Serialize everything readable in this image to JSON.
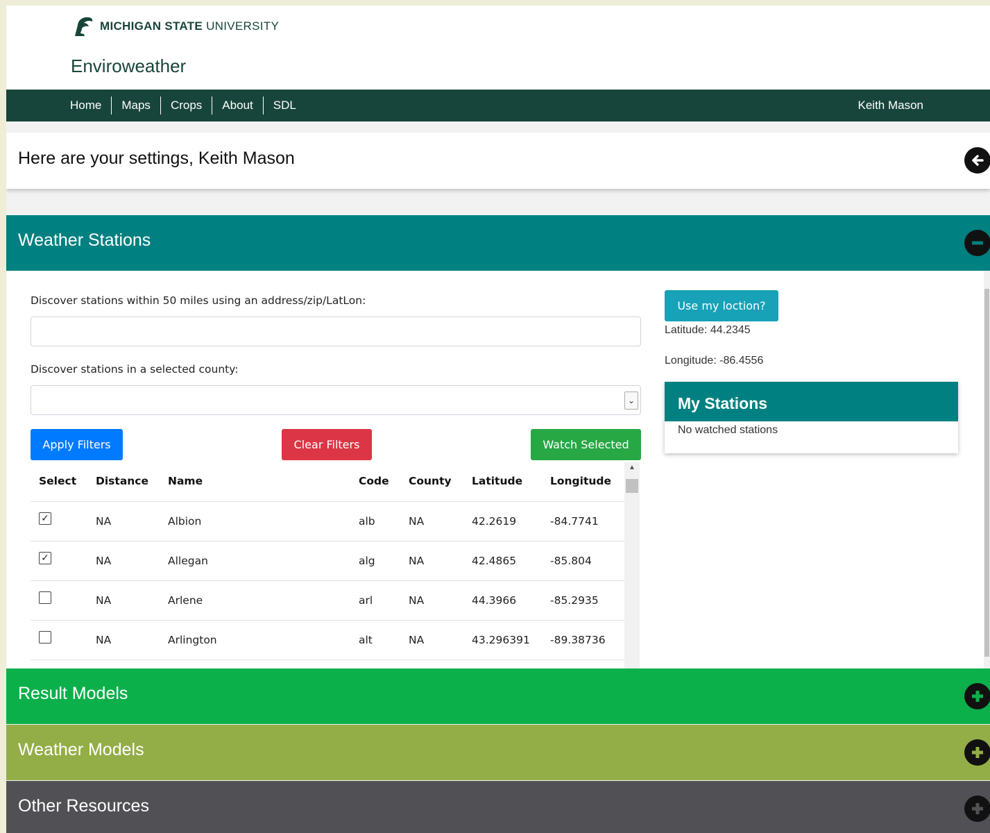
{
  "header": {
    "university_bold": "MICHIGAN STATE",
    "university_light": "UNIVERSITY",
    "site_title": "Enviroweather"
  },
  "nav": {
    "items": [
      "Home",
      "Maps",
      "Crops",
      "About",
      "SDL"
    ],
    "user": "Keith Mason"
  },
  "settings": {
    "title": "Here are your settings, Keith Mason"
  },
  "weather_stations": {
    "title": "Weather Stations",
    "discover_label": "Discover stations within 50 miles using an address/zip/LatLon:",
    "address_value": "",
    "county_label": "Discover stations in a selected county:",
    "county_value": "",
    "apply_button": "Apply Filters",
    "clear_button": "Clear Filters",
    "watch_button": "Watch Selected",
    "table": {
      "headers": [
        "Select",
        "Distance",
        "Name",
        "Code",
        "County",
        "Latitude",
        "Longitude"
      ],
      "rows": [
        {
          "checked": true,
          "distance": "NA",
          "name": "Albion",
          "code": "alb",
          "county": "NA",
          "latitude": "42.2619",
          "longitude": "-84.7741"
        },
        {
          "checked": true,
          "distance": "NA",
          "name": "Allegan",
          "code": "alg",
          "county": "NA",
          "latitude": "42.4865",
          "longitude": "-85.804"
        },
        {
          "checked": false,
          "distance": "NA",
          "name": "Arlene",
          "code": "arl",
          "county": "NA",
          "latitude": "44.3966",
          "longitude": "-85.2935"
        },
        {
          "checked": false,
          "distance": "NA",
          "name": "Arlington",
          "code": "alt",
          "county": "NA",
          "latitude": "43.296391",
          "longitude": "-89.38736"
        }
      ]
    },
    "location_button": "Use my loction?",
    "latitude_text": "Latitude: 44.2345",
    "longitude_text": "Longitude: -86.4556",
    "my_stations": {
      "title": "My Stations",
      "empty_text": "No watched stations"
    }
  },
  "sections": {
    "result_models": "Result Models",
    "weather_models": "Weather Models",
    "other_resources": "Other Resources"
  },
  "colors": {
    "msu_green": "#18453b",
    "teal": "#008080",
    "result_green": "#0bb04b",
    "olive": "#93ae47",
    "dark_gray": "#515155",
    "apply_blue": "#007bff",
    "clear_red": "#dc3545",
    "watch_green": "#28a745",
    "info_teal": "#17a2b8"
  }
}
